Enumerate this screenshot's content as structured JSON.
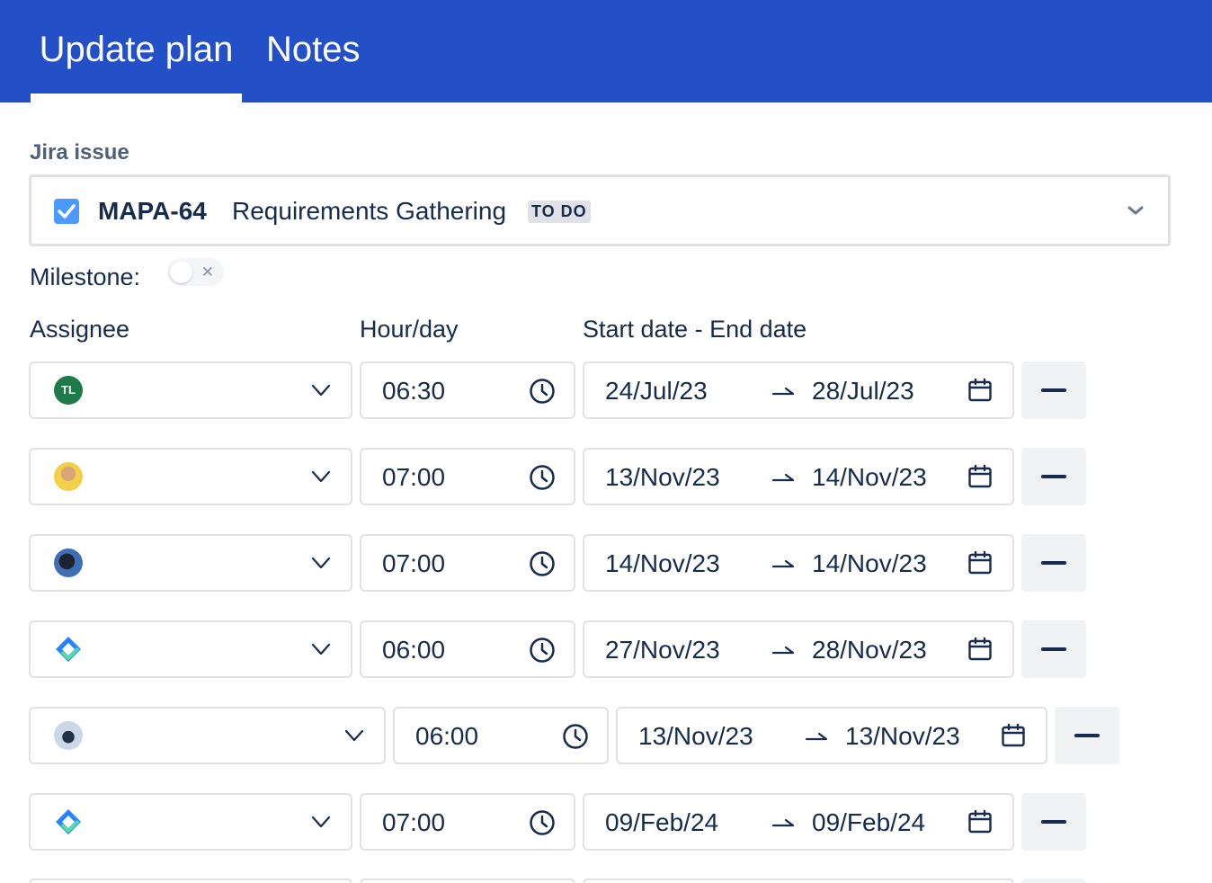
{
  "tabs": {
    "update_plan": "Update plan",
    "notes": "Notes"
  },
  "form": {
    "jira_issue_label": "Jira issue",
    "issue": {
      "key": "MAPA-64",
      "summary": "Requirements Gathering",
      "status": "TO DO"
    },
    "milestone_label": "Milestone:",
    "milestone_on": false,
    "columns": {
      "assignee": "Assignee",
      "hour": "Hour/day",
      "dates": "Start date - End date"
    }
  },
  "rows": [
    {
      "avatar_initials": "TL",
      "hours": "06:30",
      "start": "24/Jul/23",
      "end": "28/Jul/23"
    },
    {
      "hours": "07:00",
      "start": "13/Nov/23",
      "end": "14/Nov/23"
    },
    {
      "hours": "07:00",
      "start": "14/Nov/23",
      "end": "14/Nov/23"
    },
    {
      "hours": "06:00",
      "start": "27/Nov/23",
      "end": "28/Nov/23"
    },
    {
      "hours": "06:00",
      "start": "13/Nov/23",
      "end": "13/Nov/23"
    },
    {
      "hours": "07:00",
      "start": "09/Feb/24",
      "end": "09/Feb/24"
    }
  ],
  "colors": {
    "header_bg": "#2350c6",
    "accent": "#4c9aff",
    "text": "#172b4d",
    "border": "#dfe1e6",
    "initials_avatar": "#1f7a4a"
  }
}
